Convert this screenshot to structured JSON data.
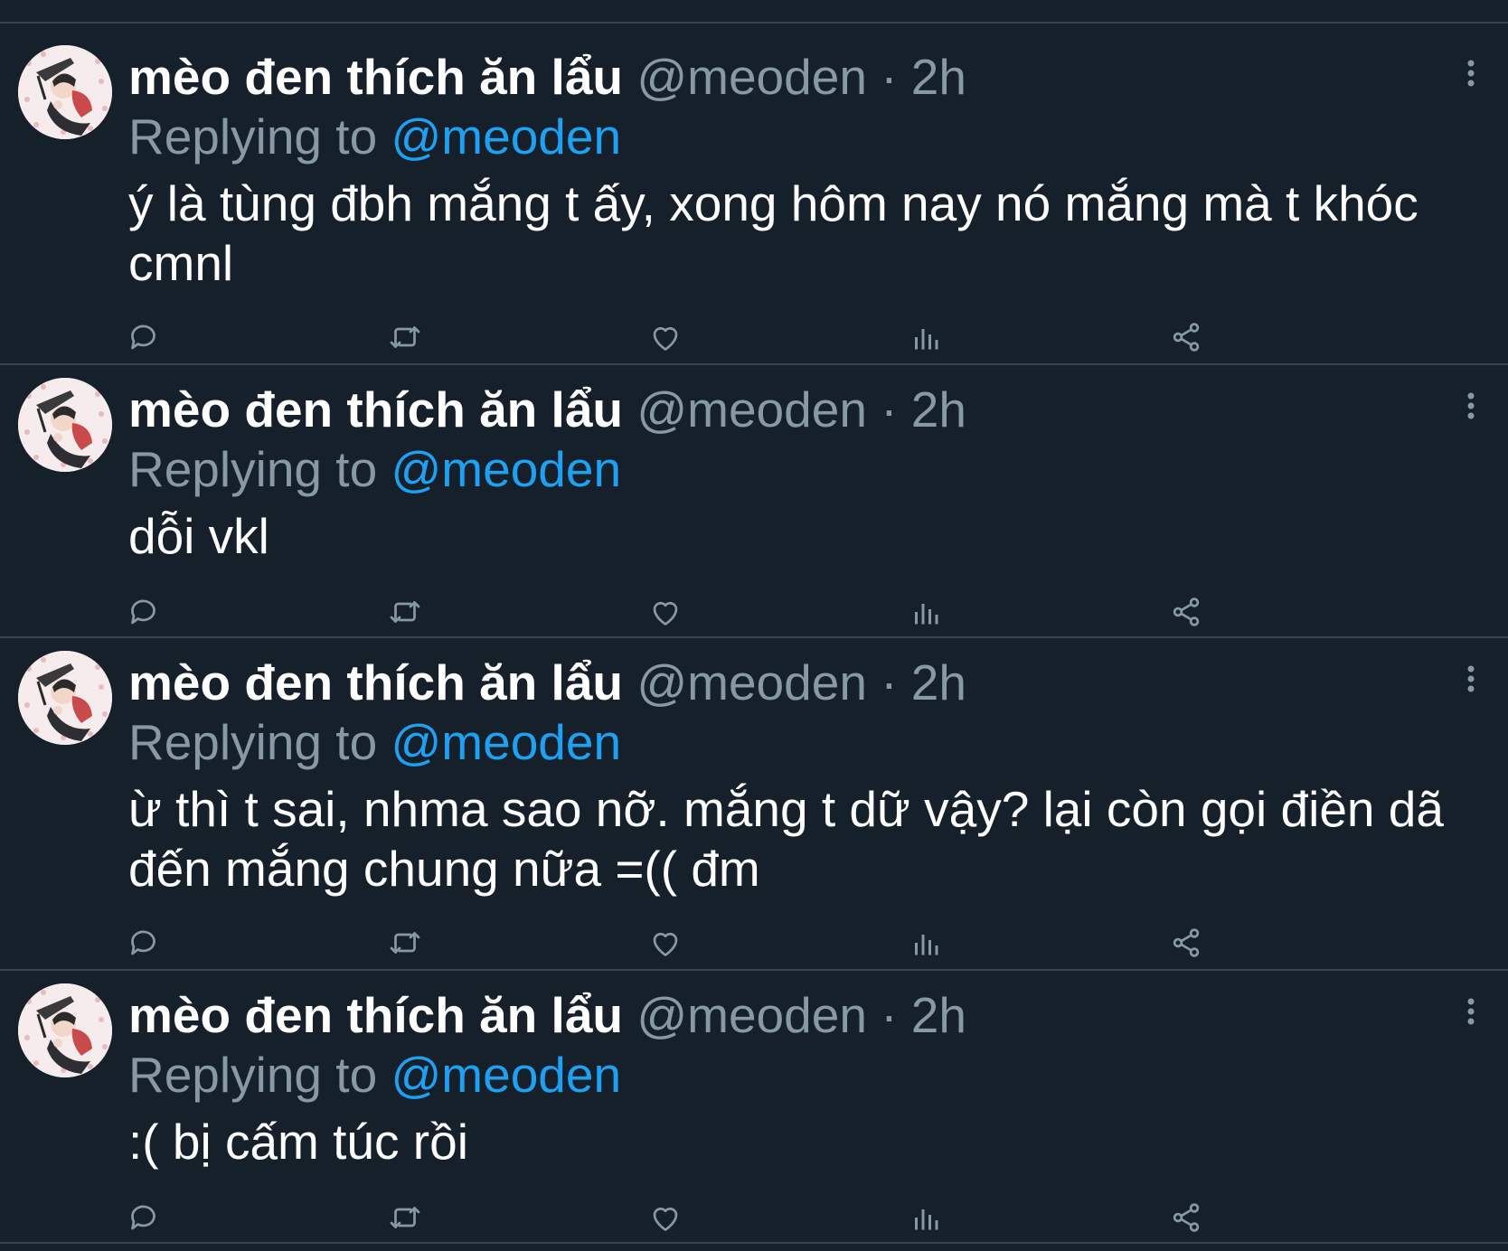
{
  "tweets": [
    {
      "display_name": "mèo đen thích ăn lẩu",
      "handle": "@meoden",
      "separator": "·",
      "time": "2h",
      "replying_prefix": "Replying to",
      "replying_to": "@meoden",
      "text": "ý là tùng đbh mắng t ấy, xong hôm nay nó mắng mà t khóc cmnl"
    },
    {
      "display_name": "mèo đen thích ăn lẩu",
      "handle": "@meoden",
      "separator": "·",
      "time": "2h",
      "replying_prefix": "Replying to",
      "replying_to": "@meoden",
      "text": "dỗi vkl"
    },
    {
      "display_name": "mèo đen thích ăn lẩu",
      "handle": "@meoden",
      "separator": "·",
      "time": "2h",
      "replying_prefix": "Replying to",
      "replying_to": "@meoden",
      "text": "ừ thì t sai, nhma sao nỡ. mắng t dữ vậy? lại còn gọi điền dã đến mắng chung nữa =(( đm"
    },
    {
      "display_name": "mèo đen thích ăn lẩu",
      "handle": "@meoden",
      "separator": "·",
      "time": "2h",
      "replying_prefix": "Replying to",
      "replying_to": "@meoden",
      "text": ":( bị cấm túc rồi"
    }
  ],
  "icons": {
    "reply": "reply-icon",
    "retweet": "retweet-icon",
    "like": "heart-icon",
    "views": "analytics-icon",
    "share": "share-icon",
    "more": "more-options-icon"
  },
  "colors": {
    "background": "#15202b",
    "divider": "#38444d",
    "secondary_text": "#8899a6",
    "link": "#1da1f2",
    "primary_text": "#ffffff"
  }
}
